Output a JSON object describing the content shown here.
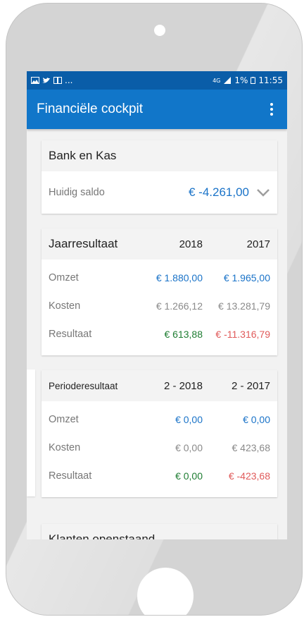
{
  "status_bar": {
    "left_dots": "...",
    "signal": "4G",
    "battery": "1%",
    "time": "11:55"
  },
  "app_bar": {
    "title": "Financiële cockpit",
    "menu_icon": "more-vert-icon"
  },
  "bank": {
    "title": "Bank en Kas",
    "label": "Huidig saldo",
    "value": "€ -4.261,00",
    "expand_icon": "chevron-down-icon"
  },
  "jaar": {
    "title": "Jaarresultaat",
    "col_a": "2018",
    "col_b": "2017",
    "rows": [
      {
        "label": "Omzet",
        "a": "€ 1.880,00",
        "b": "€ 1.965,00"
      },
      {
        "label": "Kosten",
        "a": "€ 1.266,12",
        "b": "€ 13.281,79"
      },
      {
        "label": "Resultaat",
        "a": "€ 613,88",
        "b": "€ -11.316,79"
      }
    ]
  },
  "periode": {
    "title": "Perioderesultaat",
    "col_a": "2 - 2018",
    "col_b": "2 - 2017",
    "rows": [
      {
        "label": "Omzet",
        "a": "€ 0,00",
        "b": "€ 0,00"
      },
      {
        "label": "Kosten",
        "a": "€ 0,00",
        "b": "€ 423,68"
      },
      {
        "label": "Resultaat",
        "a": "€ 0,00",
        "b": "€ -423,68"
      }
    ]
  },
  "klanten": {
    "title": "Klanten openstaand"
  },
  "colors": {
    "app_bar": "#1176c9",
    "status_bar": "#0a5da8",
    "positive_blue": "#1a73c8",
    "result_green": "#1e7d32",
    "result_red": "#e05a5a"
  }
}
